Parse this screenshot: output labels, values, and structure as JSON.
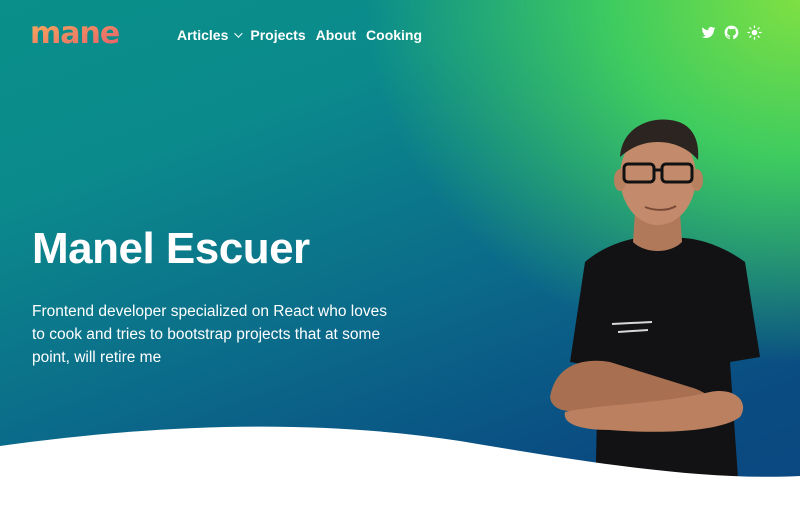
{
  "logo": {
    "text": "manel"
  },
  "nav": {
    "items": [
      {
        "label": "Articles",
        "has_dropdown": true
      },
      {
        "label": "Projects",
        "has_dropdown": false
      },
      {
        "label": "About",
        "has_dropdown": false
      },
      {
        "label": "Cooking",
        "has_dropdown": false
      }
    ]
  },
  "social_icons": [
    "twitter-icon",
    "github-icon",
    "sun-icon"
  ],
  "hero": {
    "title": "Manel Escuer",
    "subtitle": "Frontend developer specialized on React who loves to cook and tries to bootstrap projects that at some point, will retire me"
  },
  "colors": {
    "gradient_green": "#7ee043",
    "gradient_teal": "#0a8f8a",
    "gradient_blue": "#0b4680",
    "text": "#ffffff",
    "logo_orange": "#f4a24b",
    "logo_pink": "#e8606d"
  }
}
